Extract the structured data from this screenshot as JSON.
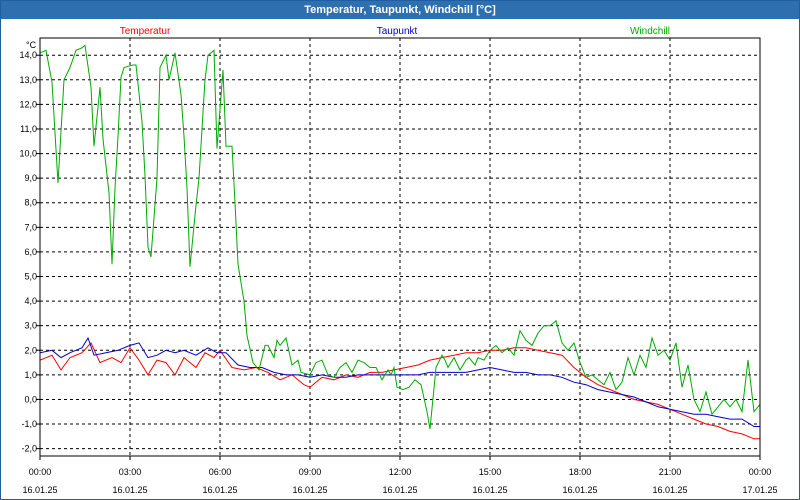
{
  "window": {
    "title": "Temperatur, Taupunkt, Windchill [°C]"
  },
  "chart_data": {
    "type": "line",
    "title": "Temperatur, Taupunkt, Windchill [°C]",
    "ylabel": "°C",
    "ylim": [
      -2.3,
      14.7
    ],
    "xlim": [
      0,
      24
    ],
    "grid": true,
    "legend_placement": "top",
    "yticks": [
      -2.0,
      -1.0,
      0.0,
      1.0,
      2.0,
      3.0,
      4.0,
      5.0,
      6.0,
      7.0,
      8.0,
      9.0,
      10.0,
      11.0,
      12.0,
      13.0,
      14.0
    ],
    "ytick_labels": [
      "-2,0",
      "-1,0",
      "0,0",
      "1,0",
      "2,0",
      "3,0",
      "4,0",
      "5,0",
      "6,0",
      "7,0",
      "8,0",
      "9,0",
      "10,0",
      "11,0",
      "12,0",
      "13,0",
      "14,0"
    ],
    "xticks": [
      0,
      3,
      6,
      9,
      12,
      15,
      18,
      21,
      24
    ],
    "xtick_labels": [
      {
        "time": "00:00",
        "date": "16.01.25"
      },
      {
        "time": "03:00",
        "date": "16.01.25"
      },
      {
        "time": "06:00",
        "date": "16.01.25"
      },
      {
        "time": "09:00",
        "date": "16.01.25"
      },
      {
        "time": "12:00",
        "date": "16.01.25"
      },
      {
        "time": "15:00",
        "date": "16.01.25"
      },
      {
        "time": "18:00",
        "date": "16.01.25"
      },
      {
        "time": "21:00",
        "date": "16.01.25"
      },
      {
        "time": "00:00",
        "date": "17.01.25"
      }
    ],
    "series": [
      {
        "name": "Temperatur",
        "color": "#ff0000",
        "points": [
          [
            0,
            1.6
          ],
          [
            0.4,
            1.8
          ],
          [
            0.7,
            1.2
          ],
          [
            1.0,
            1.7
          ],
          [
            1.4,
            1.9
          ],
          [
            1.7,
            2.3
          ],
          [
            2.0,
            1.5
          ],
          [
            2.4,
            1.7
          ],
          [
            2.7,
            1.5
          ],
          [
            3.0,
            2.1
          ],
          [
            3.3,
            1.6
          ],
          [
            3.6,
            1.0
          ],
          [
            3.9,
            1.6
          ],
          [
            4.2,
            1.5
          ],
          [
            4.5,
            1.0
          ],
          [
            4.8,
            1.7
          ],
          [
            5.2,
            1.3
          ],
          [
            5.5,
            1.9
          ],
          [
            5.8,
            1.7
          ],
          [
            6.0,
            2.0
          ],
          [
            6.4,
            1.3
          ],
          [
            6.8,
            1.2
          ],
          [
            7.2,
            1.3
          ],
          [
            7.6,
            1.1
          ],
          [
            8.0,
            0.8
          ],
          [
            8.4,
            1.0
          ],
          [
            8.8,
            0.6
          ],
          [
            9.0,
            0.5
          ],
          [
            9.4,
            0.9
          ],
          [
            9.8,
            0.8
          ],
          [
            10.2,
            1.0
          ],
          [
            10.6,
            0.9
          ],
          [
            11.0,
            1.1
          ],
          [
            11.4,
            1.1
          ],
          [
            11.8,
            1.2
          ],
          [
            12.2,
            1.3
          ],
          [
            12.6,
            1.4
          ],
          [
            13.0,
            1.6
          ],
          [
            13.4,
            1.7
          ],
          [
            13.8,
            1.8
          ],
          [
            14.2,
            1.9
          ],
          [
            14.6,
            1.9
          ],
          [
            15.0,
            2.0
          ],
          [
            15.4,
            2.0
          ],
          [
            15.8,
            2.1
          ],
          [
            16.2,
            2.1
          ],
          [
            16.6,
            2.0
          ],
          [
            17.0,
            1.9
          ],
          [
            17.4,
            1.8
          ],
          [
            17.8,
            1.3
          ],
          [
            18.2,
            0.9
          ],
          [
            18.6,
            0.6
          ],
          [
            19.0,
            0.4
          ],
          [
            19.4,
            0.2
          ],
          [
            19.8,
            0.0
          ],
          [
            20.2,
            -0.1
          ],
          [
            20.6,
            -0.2
          ],
          [
            21.0,
            -0.4
          ],
          [
            21.4,
            -0.6
          ],
          [
            21.8,
            -0.8
          ],
          [
            22.2,
            -1.0
          ],
          [
            22.6,
            -1.1
          ],
          [
            23.0,
            -1.3
          ],
          [
            23.4,
            -1.4
          ],
          [
            23.8,
            -1.6
          ],
          [
            24.0,
            -1.6
          ]
        ]
      },
      {
        "name": "Taupunkt",
        "color": "#0000cc",
        "points": [
          [
            0,
            1.9
          ],
          [
            0.4,
            2.0
          ],
          [
            0.7,
            1.7
          ],
          [
            1.0,
            1.9
          ],
          [
            1.4,
            2.1
          ],
          [
            1.6,
            2.5
          ],
          [
            1.8,
            1.8
          ],
          [
            2.2,
            1.9
          ],
          [
            2.6,
            2.0
          ],
          [
            3.0,
            2.2
          ],
          [
            3.3,
            2.3
          ],
          [
            3.6,
            1.7
          ],
          [
            3.9,
            1.8
          ],
          [
            4.2,
            2.0
          ],
          [
            4.5,
            1.9
          ],
          [
            4.8,
            2.0
          ],
          [
            5.2,
            1.8
          ],
          [
            5.6,
            2.1
          ],
          [
            5.9,
            1.9
          ],
          [
            6.2,
            1.9
          ],
          [
            6.6,
            1.4
          ],
          [
            7.0,
            1.3
          ],
          [
            7.4,
            1.3
          ],
          [
            7.8,
            1.1
          ],
          [
            8.2,
            1.0
          ],
          [
            8.6,
            1.0
          ],
          [
            9.0,
            0.9
          ],
          [
            9.4,
            1.0
          ],
          [
            9.8,
            0.9
          ],
          [
            10.2,
            0.9
          ],
          [
            10.6,
            1.0
          ],
          [
            11.0,
            1.0
          ],
          [
            11.4,
            1.0
          ],
          [
            11.8,
            1.0
          ],
          [
            12.2,
            1.0
          ],
          [
            12.6,
            1.0
          ],
          [
            13.0,
            1.1
          ],
          [
            13.4,
            1.1
          ],
          [
            13.8,
            1.1
          ],
          [
            14.2,
            1.1
          ],
          [
            14.6,
            1.2
          ],
          [
            15.0,
            1.3
          ],
          [
            15.4,
            1.2
          ],
          [
            15.8,
            1.1
          ],
          [
            16.2,
            1.1
          ],
          [
            16.6,
            1.0
          ],
          [
            17.0,
            1.0
          ],
          [
            17.4,
            0.9
          ],
          [
            17.8,
            0.7
          ],
          [
            18.2,
            0.6
          ],
          [
            18.6,
            0.4
          ],
          [
            19.0,
            0.3
          ],
          [
            19.4,
            0.2
          ],
          [
            19.8,
            0.1
          ],
          [
            20.2,
            -0.1
          ],
          [
            20.6,
            -0.3
          ],
          [
            21.0,
            -0.4
          ],
          [
            21.4,
            -0.5
          ],
          [
            21.8,
            -0.6
          ],
          [
            22.2,
            -0.6
          ],
          [
            22.6,
            -0.7
          ],
          [
            23.0,
            -0.8
          ],
          [
            23.4,
            -0.8
          ],
          [
            23.8,
            -1.1
          ],
          [
            24.0,
            -1.1
          ]
        ]
      },
      {
        "name": "Windchill",
        "color": "#00aa00",
        "points": [
          [
            0,
            14.1
          ],
          [
            0.2,
            14.2
          ],
          [
            0.4,
            12.9
          ],
          [
            0.6,
            8.8
          ],
          [
            0.8,
            13.0
          ],
          [
            1.0,
            13.5
          ],
          [
            1.2,
            14.2
          ],
          [
            1.4,
            14.3
          ],
          [
            1.5,
            14.4
          ],
          [
            1.7,
            12.7
          ],
          [
            1.8,
            10.3
          ],
          [
            2.0,
            12.7
          ],
          [
            2.1,
            10.6
          ],
          [
            2.3,
            8.4
          ],
          [
            2.4,
            5.5
          ],
          [
            2.5,
            8.6
          ],
          [
            2.6,
            10.7
          ],
          [
            2.7,
            13.1
          ],
          [
            2.8,
            13.5
          ],
          [
            3.1,
            13.6
          ],
          [
            3.2,
            13.6
          ],
          [
            3.4,
            11.3
          ],
          [
            3.5,
            9.1
          ],
          [
            3.6,
            6.2
          ],
          [
            3.7,
            5.8
          ],
          [
            3.9,
            9.0
          ],
          [
            4.0,
            13.5
          ],
          [
            4.2,
            14.0
          ],
          [
            4.3,
            13.0
          ],
          [
            4.5,
            14.1
          ],
          [
            4.7,
            12.4
          ],
          [
            4.8,
            10.7
          ],
          [
            4.9,
            8.6
          ],
          [
            5.0,
            5.4
          ],
          [
            5.2,
            7.9
          ],
          [
            5.3,
            9.0
          ],
          [
            5.5,
            13.0
          ],
          [
            5.6,
            14.0
          ],
          [
            5.8,
            14.2
          ],
          [
            5.9,
            10.2
          ],
          [
            6.1,
            13.4
          ],
          [
            6.2,
            10.3
          ],
          [
            6.4,
            10.3
          ],
          [
            6.5,
            8.0
          ],
          [
            6.6,
            5.5
          ],
          [
            6.8,
            4.0
          ],
          [
            6.9,
            2.6
          ],
          [
            7.1,
            1.5
          ],
          [
            7.3,
            1.2
          ],
          [
            7.5,
            2.2
          ],
          [
            7.6,
            2.2
          ],
          [
            7.8,
            1.7
          ],
          [
            7.9,
            2.4
          ],
          [
            8.0,
            2.2
          ],
          [
            8.2,
            2.5
          ],
          [
            8.4,
            1.4
          ],
          [
            8.6,
            1.6
          ],
          [
            8.7,
            1.1
          ],
          [
            9.0,
            1.0
          ],
          [
            9.2,
            1.5
          ],
          [
            9.4,
            1.6
          ],
          [
            9.6,
            1.0
          ],
          [
            9.8,
            0.9
          ],
          [
            10.0,
            1.3
          ],
          [
            10.2,
            1.5
          ],
          [
            10.4,
            1.1
          ],
          [
            10.6,
            1.6
          ],
          [
            10.8,
            1.5
          ],
          [
            11.0,
            1.3
          ],
          [
            11.2,
            1.3
          ],
          [
            11.4,
            0.8
          ],
          [
            11.6,
            1.2
          ],
          [
            11.7,
            1.0
          ],
          [
            11.8,
            1.3
          ],
          [
            11.9,
            0.5
          ],
          [
            12.1,
            0.4
          ],
          [
            12.3,
            0.5
          ],
          [
            12.5,
            0.8
          ],
          [
            12.7,
            0.6
          ],
          [
            12.9,
            -0.5
          ],
          [
            13.0,
            -1.2
          ],
          [
            13.2,
            1.3
          ],
          [
            13.4,
            1.8
          ],
          [
            13.5,
            1.6
          ],
          [
            13.6,
            1.3
          ],
          [
            13.8,
            1.7
          ],
          [
            14.0,
            1.2
          ],
          [
            14.2,
            1.6
          ],
          [
            14.3,
            1.7
          ],
          [
            14.5,
            1.4
          ],
          [
            14.6,
            1.7
          ],
          [
            14.8,
            1.6
          ],
          [
            15.0,
            2.0
          ],
          [
            15.2,
            2.2
          ],
          [
            15.4,
            1.9
          ],
          [
            15.6,
            2.1
          ],
          [
            15.8,
            1.8
          ],
          [
            16.0,
            2.8
          ],
          [
            16.2,
            2.4
          ],
          [
            16.4,
            2.2
          ],
          [
            16.6,
            2.7
          ],
          [
            16.8,
            3.0
          ],
          [
            17.0,
            3.0
          ],
          [
            17.2,
            3.2
          ],
          [
            17.4,
            2.3
          ],
          [
            17.6,
            2.0
          ],
          [
            17.8,
            2.3
          ],
          [
            18.0,
            1.5
          ],
          [
            18.2,
            0.9
          ],
          [
            18.4,
            1.0
          ],
          [
            18.6,
            0.8
          ],
          [
            18.8,
            0.6
          ],
          [
            19.0,
            1.1
          ],
          [
            19.2,
            0.4
          ],
          [
            19.4,
            0.7
          ],
          [
            19.6,
            1.7
          ],
          [
            19.8,
            1.0
          ],
          [
            20.0,
            1.8
          ],
          [
            20.2,
            1.3
          ],
          [
            20.4,
            2.5
          ],
          [
            20.6,
            1.8
          ],
          [
            20.8,
            2.0
          ],
          [
            21.0,
            1.6
          ],
          [
            21.2,
            2.3
          ],
          [
            21.4,
            0.5
          ],
          [
            21.6,
            1.4
          ],
          [
            21.8,
            0.0
          ],
          [
            22.0,
            -0.5
          ],
          [
            22.2,
            0.3
          ],
          [
            22.4,
            -0.6
          ],
          [
            22.6,
            -0.3
          ],
          [
            22.8,
            0.0
          ],
          [
            23.0,
            -0.3
          ],
          [
            23.2,
            0.0
          ],
          [
            23.4,
            -0.5
          ],
          [
            23.6,
            1.6
          ],
          [
            23.8,
            -0.5
          ],
          [
            24.0,
            -0.2
          ]
        ]
      }
    ]
  }
}
